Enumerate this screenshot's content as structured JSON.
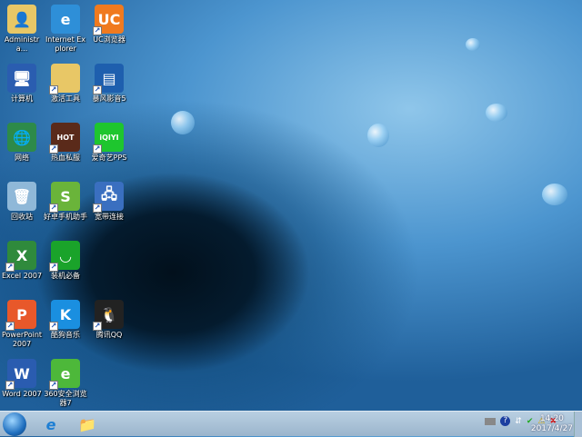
{
  "desktop_icons": [
    {
      "label": "Administra...",
      "icon": "user-folder-icon",
      "color": "#e8c766",
      "glyph": "👤"
    },
    {
      "label": "Internet Explorer",
      "icon": "internet-explorer-icon",
      "color": "#2e8fd8",
      "glyph": "e"
    },
    {
      "label": "UC浏览器",
      "icon": "uc-browser-icon",
      "color": "#f07a1f",
      "glyph": "UC",
      "shortcut": true
    },
    {
      "label": "计算机",
      "icon": "computer-icon",
      "color": "#2a5db0",
      "glyph": "🖥"
    },
    {
      "label": "激活工具",
      "icon": "folder-icon",
      "color": "#e8c766",
      "glyph": "",
      "shortcut": true
    },
    {
      "label": "暴风影音5",
      "icon": "baofeng-icon",
      "color": "#1e5fae",
      "glyph": "▤",
      "shortcut": true
    },
    {
      "label": "网络",
      "icon": "network-icon",
      "color": "#2d8a4a",
      "glyph": "🌐"
    },
    {
      "label": "热血私服",
      "icon": "game-icon",
      "color": "#5a2a1a",
      "glyph": "HOT",
      "shortcut": true
    },
    {
      "label": "爱奇艺PPS",
      "icon": "iqiyi-icon",
      "color": "#1ec62e",
      "glyph": "iQIYI",
      "shortcut": true
    },
    {
      "label": "回收站",
      "icon": "recycle-bin-icon",
      "color": "#8fb8d8",
      "glyph": "🗑"
    },
    {
      "label": "好卓手机助手",
      "icon": "phone-assistant-icon",
      "color": "#6ab43a",
      "glyph": "S",
      "shortcut": true
    },
    {
      "label": "宽带连接",
      "icon": "broadband-icon",
      "color": "#3a6fc0",
      "glyph": "🖧",
      "shortcut": true
    },
    {
      "label": "Excel 2007",
      "icon": "excel-icon",
      "color": "#2f8a3c",
      "glyph": "X",
      "shortcut": true
    },
    {
      "label": "装机必备",
      "icon": "shopping-bag-icon",
      "color": "#1aa32a",
      "glyph": "◡",
      "shortcut": true
    },
    {
      "label": "",
      "icon": "",
      "color": "",
      "glyph": ""
    },
    {
      "label": "PowerPoint 2007",
      "icon": "powerpoint-icon",
      "color": "#e8582a",
      "glyph": "P",
      "shortcut": true
    },
    {
      "label": "酷狗音乐",
      "icon": "kugou-icon",
      "color": "#1a8fe0",
      "glyph": "K",
      "shortcut": true
    },
    {
      "label": "腾讯QQ",
      "icon": "qq-penguin-icon",
      "color": "#222222",
      "glyph": "🐧",
      "shortcut": true
    },
    {
      "label": "Word 2007",
      "icon": "word-icon",
      "color": "#2a5cb0",
      "glyph": "W",
      "shortcut": true
    },
    {
      "label": "360安全浏览器7",
      "icon": "360-browser-icon",
      "color": "#4db83a",
      "glyph": "e",
      "shortcut": true
    }
  ],
  "taskbar": {
    "start": "windows-start-icon",
    "pinned": [
      {
        "icon": "internet-explorer-icon",
        "glyph": "e"
      },
      {
        "icon": "file-explorer-icon",
        "glyph": "📁"
      }
    ],
    "tray": [
      "keyboard-icon",
      "help-icon",
      "network-up-icon",
      "usb-safe-icon",
      "network-warning-icon",
      "volume-muted-icon"
    ],
    "time": "14:20",
    "date": "2017/4/27"
  }
}
